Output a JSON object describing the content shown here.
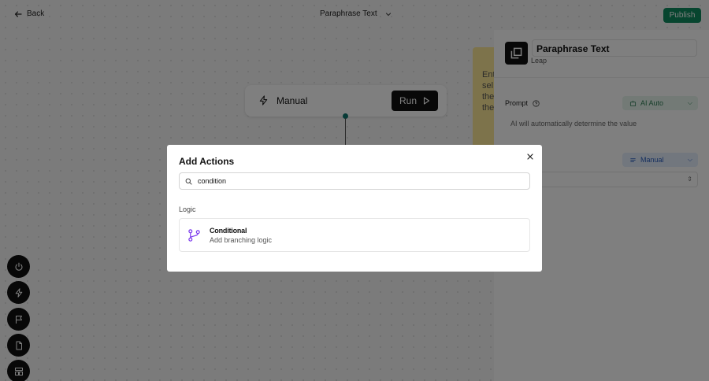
{
  "topbar": {
    "back_label": "Back",
    "title": "Paraphrase Text",
    "publish_label": "Publish"
  },
  "trigger": {
    "name": "Manual",
    "run_label": "Run"
  },
  "sticky_note": {
    "line1": "Ent",
    "line2": "sel",
    "line3": "the",
    "line4": "the"
  },
  "panel": {
    "node_name": "Paraphrase Text",
    "node_provider": "Leap",
    "prompt_label": "Prompt",
    "ai_mode_label": "AI Auto",
    "ai_note": "AI will automatically determine the value",
    "manual_mode_label": "Manual"
  },
  "side_tools": [
    "power-icon",
    "bolt-icon",
    "flag-icon",
    "file-icon",
    "layout-icon"
  ],
  "modal": {
    "title": "Add Actions",
    "search_value": "condition",
    "section_label": "Logic",
    "results": [
      {
        "title": "Conditional",
        "description": "Add branching logic"
      }
    ]
  },
  "colors": {
    "publish": "#0f8a5f",
    "connector": "#0f766e",
    "sticky": "#fbe796",
    "branch_icon": "#7c3aed",
    "ai_auto": "#2e7d55",
    "manual": "#2b5fbf"
  }
}
